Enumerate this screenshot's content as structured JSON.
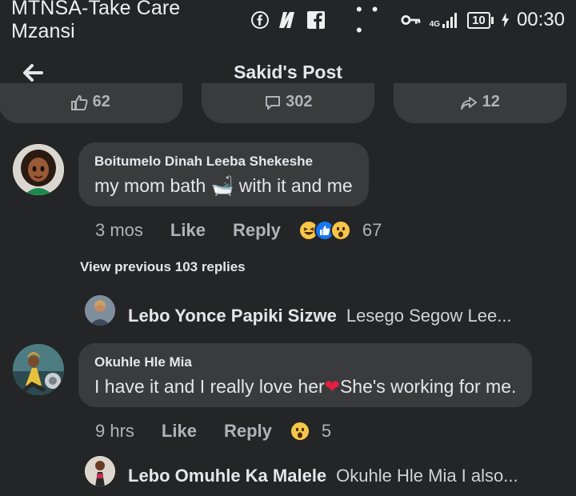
{
  "status_bar": {
    "carrier": "MTNSA-Take Care Mzansi",
    "app_icons": [
      "facebook-messenger-icon",
      "netflix-icon",
      "facebook-icon"
    ],
    "more": "• • •",
    "network": "4G",
    "battery": "10",
    "time": "00:30"
  },
  "header": {
    "title": "Sakid's Post"
  },
  "post_actions": {
    "like_count": "62",
    "comment_count": "302",
    "share_count": "12"
  },
  "comments": [
    {
      "author": "Boitumelo Dinah Leeba Shekeshe",
      "text_before": "my mom bath ",
      "emoji": "🛁",
      "text_after": " with it and me",
      "time": "3 mos",
      "like": "Like",
      "reply": "Reply",
      "reaction_count": "67",
      "view_previous": "View previous 103 replies",
      "latest_reply": {
        "author": "Lebo Yonce Papiki Sizwe",
        "text": "Lesego Segow Lee..."
      }
    },
    {
      "author": "Okuhle Hle Mia",
      "text_before": "I have it and I really love her",
      "emoji": "❤",
      "text_after": "She's working for me.",
      "time": "9 hrs",
      "like": "Like",
      "reply": "Reply",
      "reaction_count": "5",
      "latest_reply": {
        "author": "Lebo Omuhle Ka Malele",
        "text": "Okuhle Hle Mia I also..."
      }
    }
  ],
  "colors": {
    "background": "#242526",
    "bubble": "#3a3b3c",
    "muted": "#b0b3b8",
    "text": "#e4e6eb",
    "like_blue": "#1877f2",
    "heart_red": "#e41e3f",
    "haha_yellow": "#f7c64a"
  }
}
